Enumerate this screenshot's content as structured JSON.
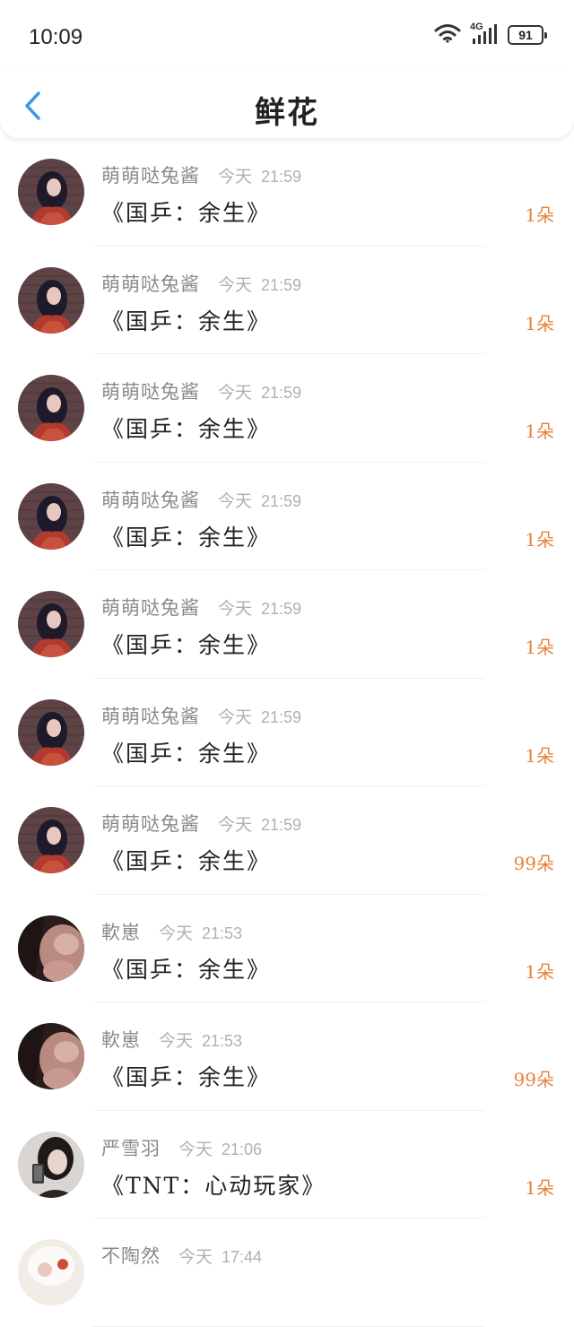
{
  "status_bar": {
    "time": "10:09",
    "battery": "91",
    "network": "4G"
  },
  "header": {
    "title": "鲜花",
    "back_icon": "chevron-left-icon"
  },
  "colors": {
    "accent": "#3a9ae8",
    "count": "#e8813a"
  },
  "items": [
    {
      "user": "萌萌哒兔酱",
      "date": "今天",
      "time": "21:59",
      "title": "《国乒：余生》",
      "count": "1朵"
    },
    {
      "user": "萌萌哒兔酱",
      "date": "今天",
      "time": "21:59",
      "title": "《国乒：余生》",
      "count": "1朵"
    },
    {
      "user": "萌萌哒兔酱",
      "date": "今天",
      "time": "21:59",
      "title": "《国乒：余生》",
      "count": "1朵"
    },
    {
      "user": "萌萌哒兔酱",
      "date": "今天",
      "time": "21:59",
      "title": "《国乒：余生》",
      "count": "1朵"
    },
    {
      "user": "萌萌哒兔酱",
      "date": "今天",
      "time": "21:59",
      "title": "《国乒：余生》",
      "count": "1朵"
    },
    {
      "user": "萌萌哒兔酱",
      "date": "今天",
      "time": "21:59",
      "title": "《国乒：余生》",
      "count": "1朵"
    },
    {
      "user": "萌萌哒兔酱",
      "date": "今天",
      "time": "21:59",
      "title": "《国乒：余生》",
      "count": "99朵"
    },
    {
      "user": "軟崽",
      "date": "今天",
      "time": "21:53",
      "title": "《国乒：余生》",
      "count": "1朵"
    },
    {
      "user": "軟崽",
      "date": "今天",
      "time": "21:53",
      "title": "《国乒：余生》",
      "count": "99朵"
    },
    {
      "user": "严雪羽",
      "date": "今天",
      "time": "21:06",
      "title": "《TNT：心动玩家》",
      "count": "1朵"
    },
    {
      "user": "不陶然",
      "date": "今天",
      "time": "17:44",
      "title": "",
      "count": ""
    }
  ]
}
